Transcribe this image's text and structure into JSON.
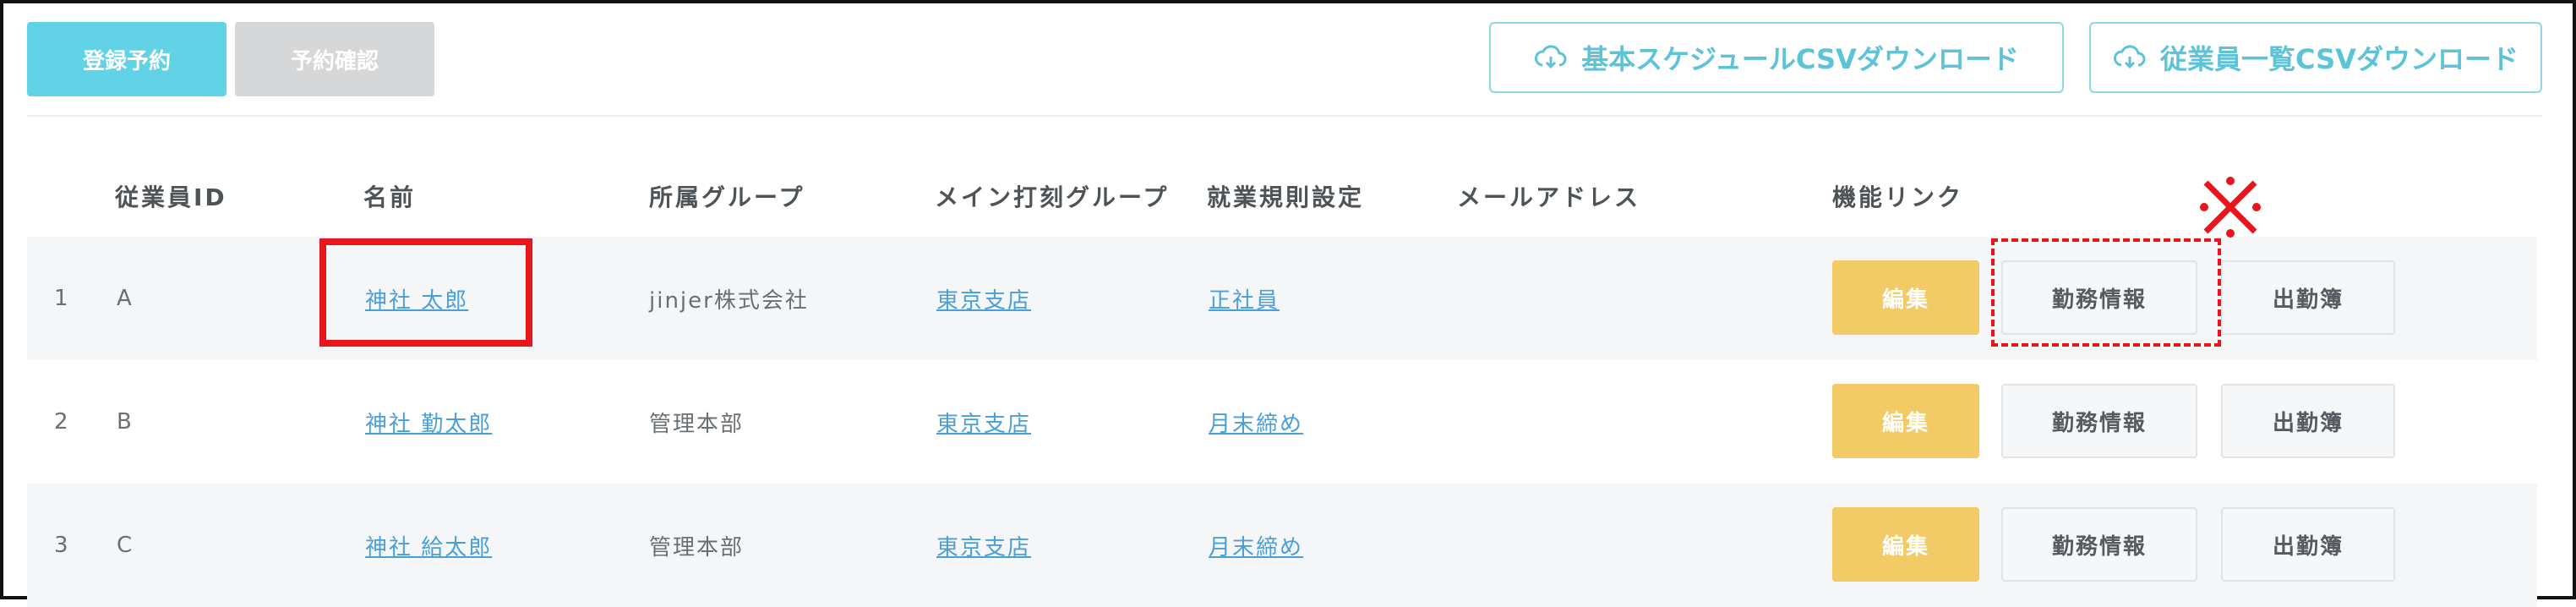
{
  "toolbar": {
    "register_label": "登録予約",
    "confirm_label": "予約確認",
    "csv_schedule_label": "基本スケジュールCSVダウンロード",
    "csv_employee_label": "従業員一覧CSVダウンロード"
  },
  "table": {
    "headers": {
      "employee_id": "従業員ID",
      "name": "名前",
      "group": "所属グループ",
      "main_stamp_group": "メイン打刻グループ",
      "work_rules": "就業規則設定",
      "email": "メールアドレス",
      "function_links": "機能リンク"
    },
    "rows": [
      {
        "no": "1",
        "id": "A",
        "name": "神社 太郎",
        "group": "jinjer株式会社",
        "stamp_group": "東京支店",
        "rule": "正社員",
        "email": ""
      },
      {
        "no": "2",
        "id": "B",
        "name": "神社 勤太郎",
        "group": "管理本部",
        "stamp_group": "東京支店",
        "rule": "月末締め",
        "email": ""
      },
      {
        "no": "3",
        "id": "C",
        "name": "神社 給太郎",
        "group": "管理本部",
        "stamp_group": "東京支店",
        "rule": "月末締め",
        "email": ""
      }
    ],
    "actions": {
      "edit": "編集",
      "work_info": "勤務情報",
      "attendance": "出勤簿"
    }
  },
  "colors": {
    "accent": "#62d2e6",
    "edit": "#f2ca66",
    "highlight": "#e8151c",
    "link": "#4a9fd8"
  },
  "icons": {
    "csv": "cloud-download-icon",
    "annotation": "kome-mark-icon"
  }
}
